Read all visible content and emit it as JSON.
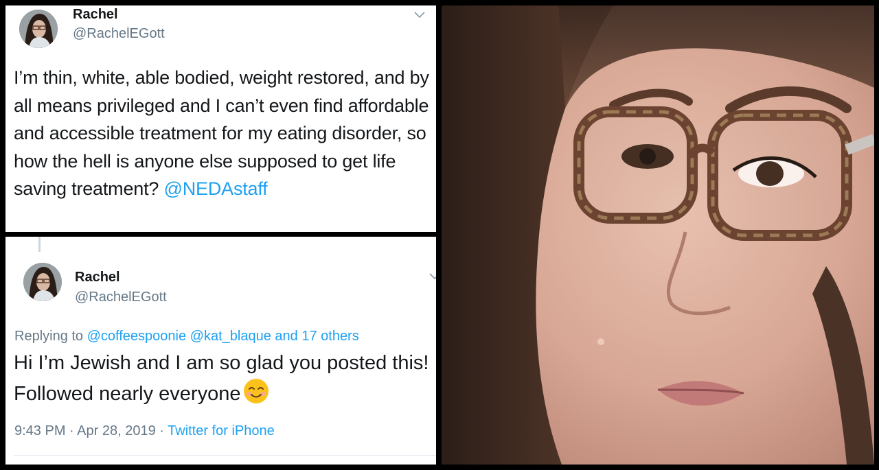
{
  "tweet_1": {
    "display_name": "Rachel",
    "handle": "@RachelEGott",
    "text_before_mention": "I’m thin, white, able bodied, weight restored, and by all means privileged and I can’t even find affordable and accessible treatment for my eating disorder, so how the hell is anyone else supposed to get life saving treatment? ",
    "mention": "@NEDAstaff",
    "menu_icon": "chevron-down-icon"
  },
  "tweet_2": {
    "display_name": "Rachel",
    "handle": "@RachelEGott",
    "replying_prefix": "Replying to ",
    "replying_to_1": "@coffeespoonie",
    "replying_to_2": "@kat_blaque",
    "replying_others": "and 17 others",
    "text": "Hi I’m Jewish and I am so glad you posted this! Followed nearly everyone",
    "emoji_icon": "smiling-face-emoji-icon",
    "time": "9:43 PM",
    "separator": "·",
    "date": "Apr 28, 2019",
    "source": "Twitter for iPhone",
    "menu_icon": "chevron-down-icon"
  },
  "colors": {
    "background": "#000000",
    "text": "#14171a",
    "secondary_text": "#657786",
    "link": "#1da1f2"
  }
}
